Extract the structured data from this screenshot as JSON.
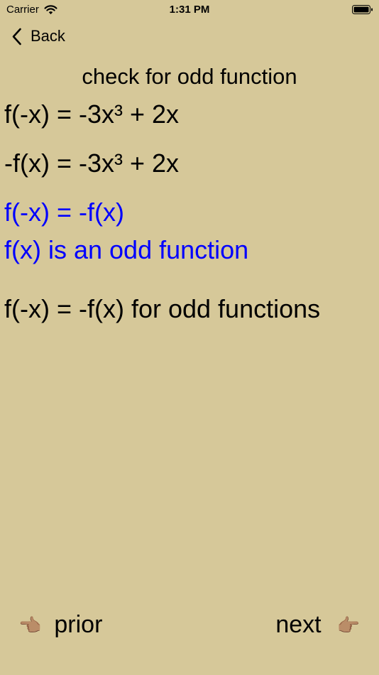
{
  "status_bar": {
    "carrier": "Carrier",
    "time": "1:31 PM"
  },
  "nav": {
    "back_label": "Back"
  },
  "title": "check for odd function",
  "equations": [
    "f(-x) = -3x³ + 2x",
    "-f(x) = -3x³ + 2x",
    "f(-x) = -f(x)",
    "f(x) is an odd function",
    "f(-x) = -f(x) for odd functions"
  ],
  "buttons": {
    "prior_label": "prior",
    "next_label": "next",
    "prior_icon": "👈🏽",
    "next_icon": "👉🏽"
  },
  "colors": {
    "background": "#d6c899",
    "highlight": "#0000ff"
  }
}
